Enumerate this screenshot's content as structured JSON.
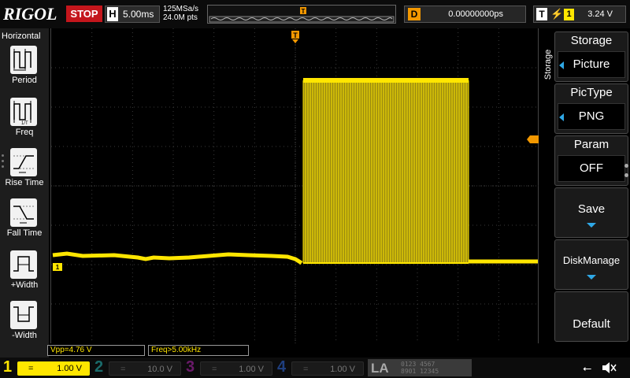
{
  "topbar": {
    "logo": "RIGOL",
    "run_state": "STOP",
    "horizontal_label": "H",
    "timebase": "5.00ms",
    "sample_rate": "125MSa/s",
    "memory_depth": "24.0M pts",
    "delay_label": "D",
    "delay_value": "0.00000000ps",
    "trigger_label": "T",
    "trigger_source": "1",
    "trigger_level": "3.24 V"
  },
  "left_menu": {
    "title": "Horizontal",
    "items": [
      {
        "label": "Period",
        "icon": "period-icon"
      },
      {
        "label": "Freq",
        "icon": "freq-icon"
      },
      {
        "label": "Rise Time",
        "icon": "rise-time-icon"
      },
      {
        "label": "Fall Time",
        "icon": "fall-time-icon"
      },
      {
        "label": "+Width",
        "icon": "positive-width-icon"
      },
      {
        "label": "-Width",
        "icon": "negative-width-icon"
      }
    ]
  },
  "measurements": {
    "vpp": "Vpp=4.76 V",
    "freq": "Freq>5.00kHz"
  },
  "right_menu": {
    "tab_label": "Storage",
    "storage": {
      "title": "Storage",
      "value": "Picture"
    },
    "pictype": {
      "title": "PicType",
      "value": "PNG"
    },
    "param": {
      "title": "Param",
      "value": "OFF"
    },
    "save": {
      "label": "Save"
    },
    "diskmanage": {
      "label": "DiskManage"
    },
    "default": {
      "label": "Default"
    }
  },
  "channels": [
    {
      "num": "1",
      "coupling": "=",
      "scale": "1.00 V",
      "color": "#ffe600",
      "active": true
    },
    {
      "num": "2",
      "coupling": "=",
      "scale": "10.0 V",
      "color": "#00b0b0",
      "active": false
    },
    {
      "num": "3",
      "coupling": "=",
      "scale": "1.00 V",
      "color": "#d020d0",
      "active": false
    },
    {
      "num": "4",
      "coupling": "=",
      "scale": "1.00 V",
      "color": "#3070e0",
      "active": false
    }
  ],
  "la": {
    "label": "LA",
    "digits_row1": "0123 4567",
    "digits_row2": "8901 12345"
  },
  "colors": {
    "trace": "#ffe600",
    "trigger_marker": "#f39800",
    "stop": "#c4161c",
    "menu_arrow": "#2fa8e6"
  }
}
